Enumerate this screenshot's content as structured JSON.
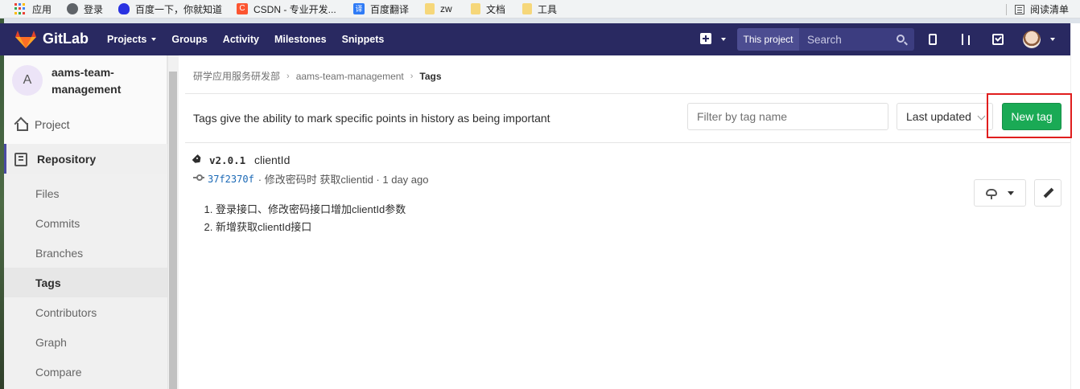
{
  "bookmarks": {
    "items": [
      {
        "label": "应用",
        "icon": "apps-grid-icon"
      },
      {
        "label": "登录",
        "icon": "globe-icon"
      },
      {
        "label": "百度一下，你就知道",
        "icon": "baidu-paw-icon"
      },
      {
        "label": "CSDN - 专业开发...",
        "icon": "csdn-icon"
      },
      {
        "label": "百度翻译",
        "icon": "translate-icon"
      },
      {
        "label": "zw",
        "icon": "folder-icon"
      },
      {
        "label": "文档",
        "icon": "folder-icon"
      },
      {
        "label": "工具",
        "icon": "folder-icon"
      }
    ],
    "reading_list": "阅读清单"
  },
  "navbar": {
    "brand": "GitLab",
    "links": [
      "Projects",
      "Groups",
      "Activity",
      "Milestones",
      "Snippets"
    ],
    "search_scope": "This project",
    "search_placeholder": "Search"
  },
  "sidebar": {
    "avatar_letter": "A",
    "project_name": "aams-team-management",
    "project_label": "Project",
    "repository_label": "Repository",
    "repo_items": [
      "Files",
      "Commits",
      "Branches",
      "Tags",
      "Contributors",
      "Graph",
      "Compare"
    ],
    "active_item": "Tags"
  },
  "breadcrumb": {
    "group": "研学应用服务研发部",
    "project": "aams-team-management",
    "current": "Tags"
  },
  "tags_page": {
    "intro": "Tags give the ability to mark specific points in history as being important",
    "filter_placeholder": "Filter by tag name",
    "sort_label": "Last updated",
    "new_tag_label": "New tag"
  },
  "tag": {
    "name": "v2.0.1",
    "message": "clientId",
    "commit_sha": "37f2370f",
    "commit_text": "· 修改密码时 获取clientid · 1 day ago",
    "release_notes": [
      "登录接口、修改密码接口增加clientId参数",
      "新增获取clientId接口"
    ]
  },
  "colors": {
    "navbar": "#292961",
    "new_tag_button": "#1aaa55",
    "highlight_box": "#e01e1e",
    "commit_link": "#1b69b6"
  }
}
